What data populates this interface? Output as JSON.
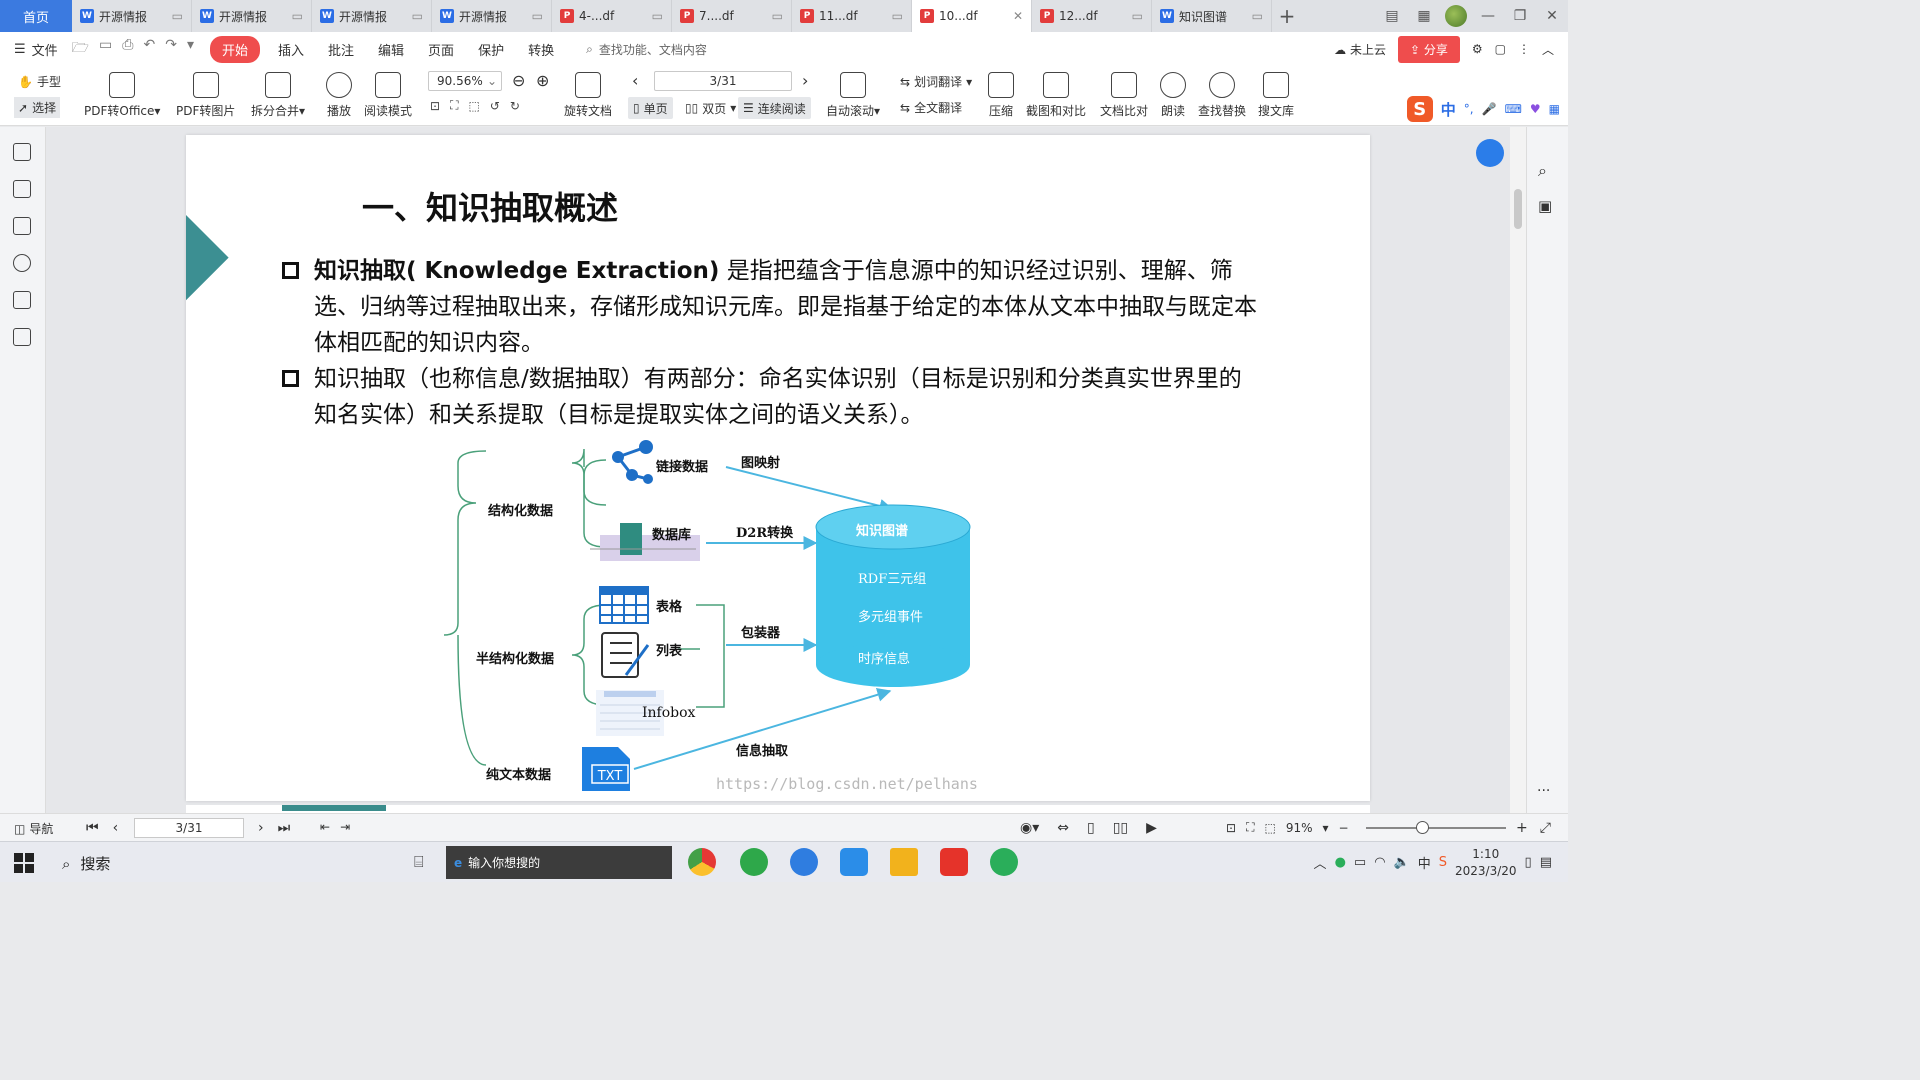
{
  "tabs": {
    "home": "首页",
    "items": [
      {
        "label": "开源情报",
        "type": "w",
        "active": false,
        "closable": false
      },
      {
        "label": "开源情报",
        "type": "w",
        "active": false,
        "closable": false
      },
      {
        "label": "开源情报",
        "type": "w",
        "active": false,
        "closable": false
      },
      {
        "label": "开源情报",
        "type": "w",
        "active": false,
        "closable": false
      },
      {
        "label": "4-...df",
        "type": "p",
        "active": false,
        "closable": false
      },
      {
        "label": "7....df",
        "type": "p",
        "active": false,
        "closable": false
      },
      {
        "label": "11...df",
        "type": "p",
        "active": false,
        "closable": false
      },
      {
        "label": "10...df",
        "type": "p",
        "active": true,
        "closable": true
      },
      {
        "label": "12...df",
        "type": "p",
        "active": false,
        "closable": false
      },
      {
        "label": "知识图谱",
        "type": "w",
        "active": false,
        "closable": false
      }
    ],
    "add": "+"
  },
  "menu": {
    "file": "文件",
    "items": [
      "开始",
      "插入",
      "批注",
      "编辑",
      "页面",
      "保护",
      "转换"
    ],
    "active": "开始",
    "search": "查找功能、文档内容",
    "cloud": "未上云",
    "share": "分享"
  },
  "toolbar": {
    "hand": "手型",
    "select": "选择",
    "pdf_office": "PDF转Office",
    "pdf_image": "PDF转图片",
    "split_merge": "拆分合并",
    "play": "播放",
    "read_mode": "阅读模式",
    "zoom": "90.56%",
    "rotate": "旋转文档",
    "page_input": "3/31",
    "single": "单页",
    "double": "双页",
    "continuous": "连续阅读",
    "auto_scroll": "自动滚动",
    "word_translate": "划词翻译",
    "full_translate": "全文翻译",
    "compress": "压缩",
    "screenshot": "截图和对比",
    "compare": "文档比对",
    "read_aloud": "朗读",
    "find_replace": "查找替换",
    "library": "搜文库",
    "ime_mode": "中"
  },
  "slide": {
    "title": "一、知识抽取概述",
    "bullet1_bold": "知识抽取( Knowledge Extraction)",
    "bullet1_rest": " 是指把蕴含于信息源中的知识经过识别、理解、筛选、归纳等过程抽取出来，存储形成知识元库。即是指基于给定的本体从文本中抽取与既定本体相匹配的知识内容。",
    "bullet2": "知识抽取（也称信息/数据抽取）有两部分：命名实体识别（目标是识别和分类真实世界里的知名实体）和关系提取（目标是提取实体之间的语义关系）。",
    "diagram": {
      "structured": "结构化数据",
      "linked": "链接数据",
      "database": "数据库",
      "graph_mapping": "图映射",
      "d2r": "D2R转换",
      "semi": "半结构化数据",
      "table": "表格",
      "list": "列表",
      "infobox": "Infobox",
      "wrapper": "包装器",
      "plain": "纯文本数据",
      "txt": "TXT",
      "extraction": "信息抽取",
      "kg_title": "知识图谱",
      "kg_1": "RDF三元组",
      "kg_2": "多元组事件",
      "kg_3": "时序信息"
    },
    "watermark": "https://blog.csdn.net/pelhans"
  },
  "status": {
    "nav": "导航",
    "page": "3/31",
    "zoom": "91%",
    "zoom_level": 0.4
  },
  "taskbar": {
    "search": "搜索",
    "input": "输入你想搜的",
    "time": "1:10",
    "date": "2023/3/20",
    "lang": "中"
  },
  "colors": {
    "accent": "#ef4d4d",
    "teal": "#3c8f92",
    "kg": "#3ec3ea"
  }
}
